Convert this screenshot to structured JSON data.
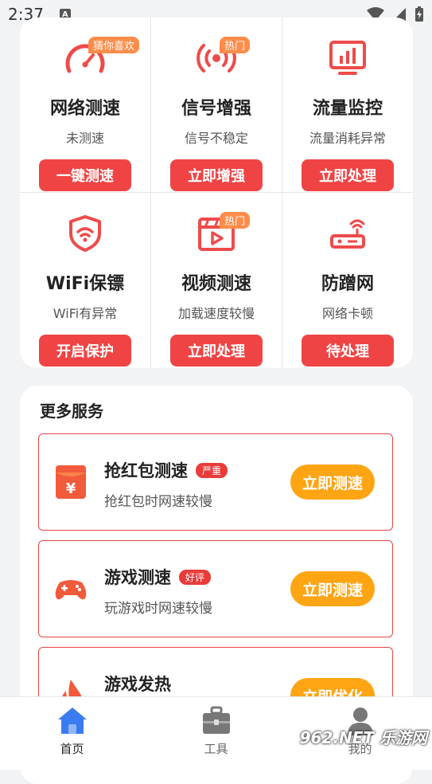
{
  "status_bar": {
    "time": "2:37",
    "notif_icon": "A"
  },
  "grid": {
    "items": [
      {
        "title": "网络测速",
        "subtitle": "未测速",
        "button": "一键测速",
        "badge": "猜你喜欢",
        "icon": "speedometer-icon"
      },
      {
        "title": "信号增强",
        "subtitle": "信号不稳定",
        "button": "立即增强",
        "badge": "热门",
        "icon": "signal-icon"
      },
      {
        "title": "流量监控",
        "subtitle": "流量消耗异常",
        "button": "立即处理",
        "badge": "",
        "icon": "monitor-chart-icon"
      },
      {
        "title": "WiFi保镖",
        "subtitle": "WiFi有异常",
        "button": "开启保护",
        "badge": "",
        "icon": "wifi-shield-icon"
      },
      {
        "title": "视频测速",
        "subtitle": "加载速度较慢",
        "button": "立即处理",
        "badge": "热门",
        "icon": "video-icon"
      },
      {
        "title": "防蹭网",
        "subtitle": "网络卡顿",
        "button": "待处理",
        "badge": "",
        "icon": "router-icon"
      }
    ]
  },
  "more_services": {
    "title": "更多服务",
    "items": [
      {
        "title": "抢红包测速",
        "tag": "严重",
        "subtitle": "抢红包时网速较慢",
        "button": "立即测速",
        "icon": "red-envelope-icon"
      },
      {
        "title": "游戏测速",
        "tag": "好评",
        "subtitle": "玩游戏时网速较慢",
        "button": "立即测速",
        "icon": "gamepad-icon"
      },
      {
        "title": "游戏发热",
        "tag": "",
        "subtitle": "",
        "button": "立即优化",
        "icon": "flame-icon"
      }
    ]
  },
  "bottom_nav": {
    "items": [
      {
        "label": "首页",
        "icon": "home-icon",
        "active": true
      },
      {
        "label": "工具",
        "icon": "toolbox-icon",
        "active": false
      },
      {
        "label": "我的",
        "icon": "user-icon",
        "active": false
      }
    ]
  },
  "watermark": "962.NET 乐游网",
  "colors": {
    "accent_red": "#f04444",
    "orange": "#ffa514",
    "badge_orange": "#ff8c4a",
    "nav_active": "#3b7bf0"
  }
}
